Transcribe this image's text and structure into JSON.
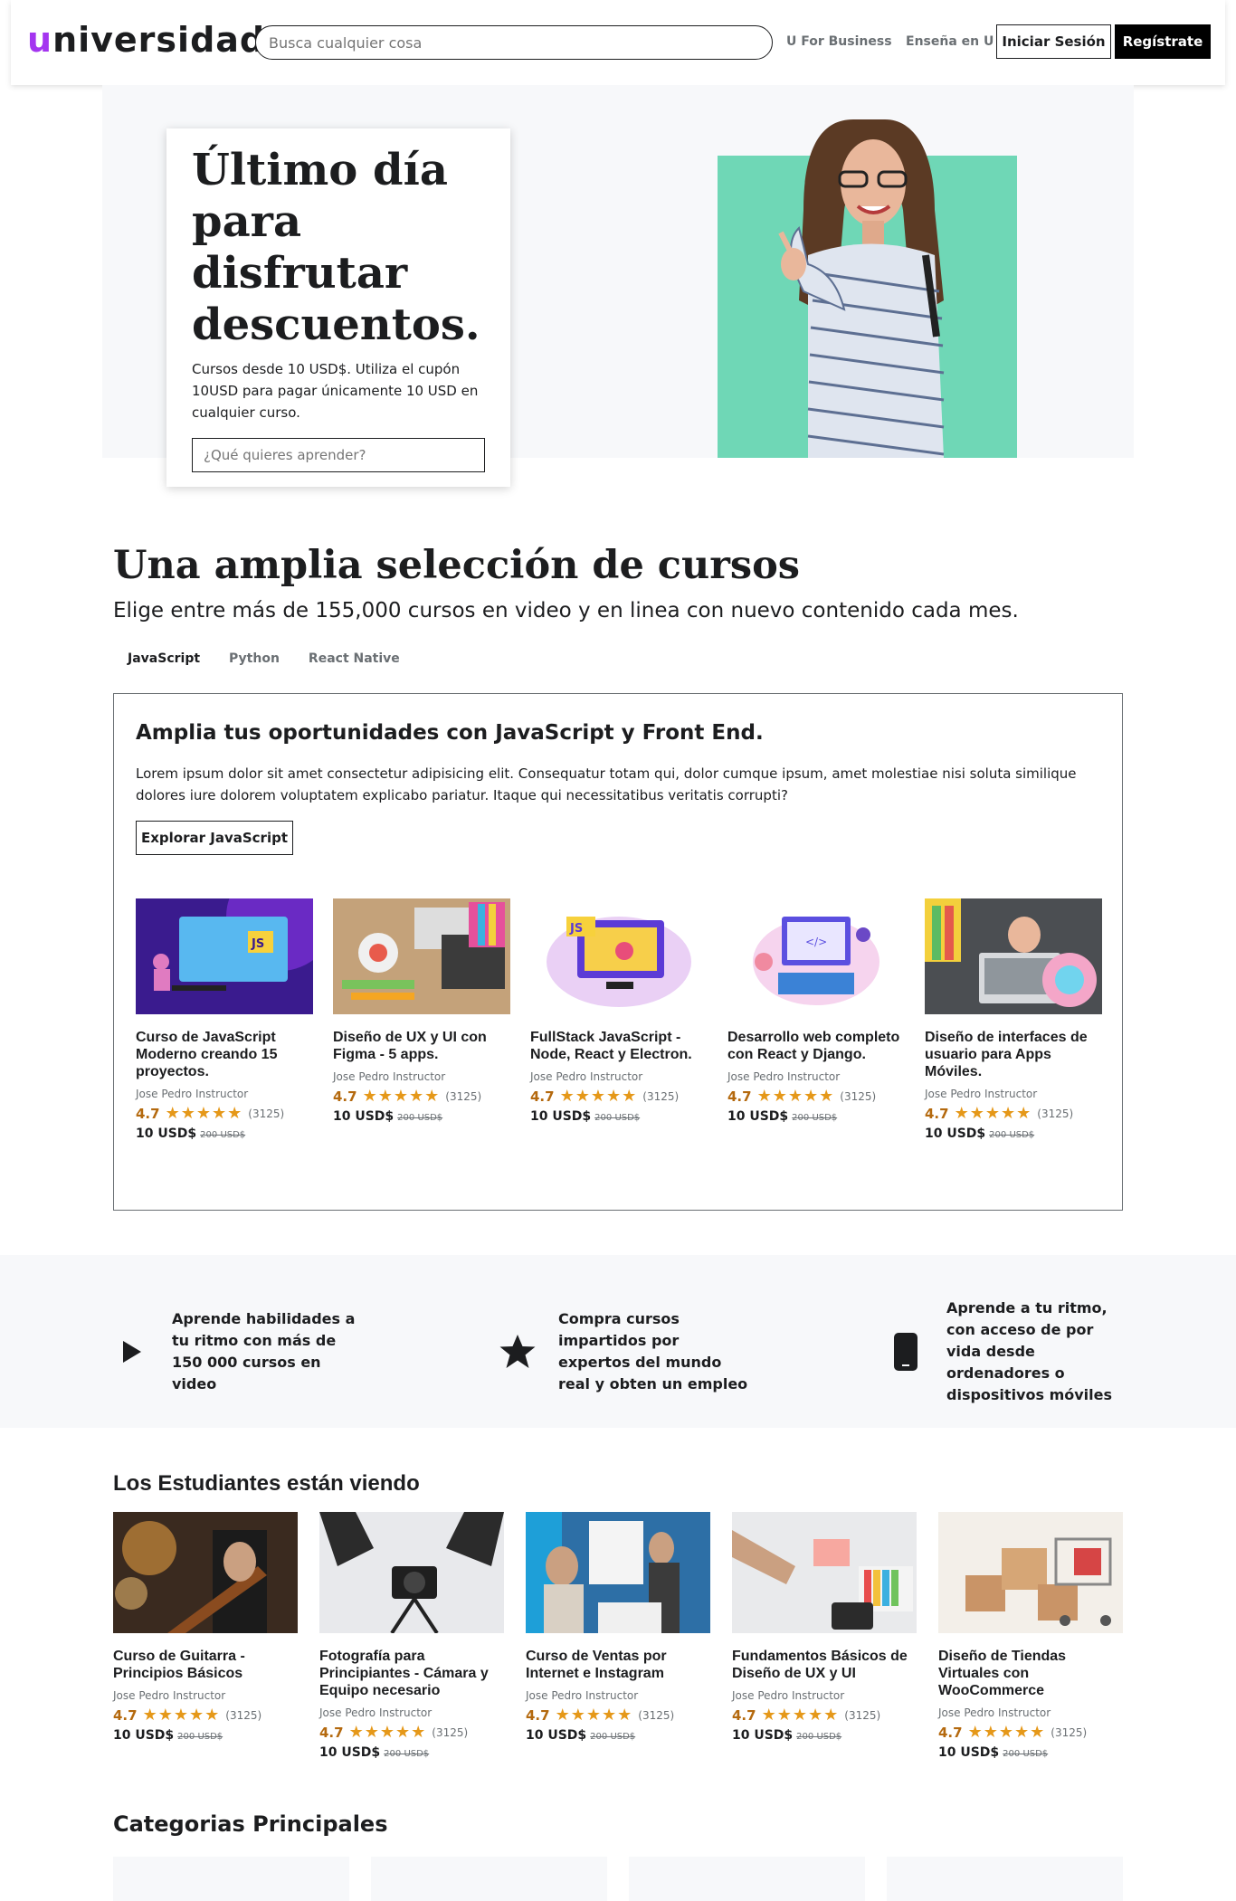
{
  "header": {
    "logo_first": "u",
    "logo_rest": "niversidad",
    "search_placeholder": "Busca cualquier cosa",
    "business_link": "U For Business",
    "teach_link": "Enseña en U",
    "login_label": "Iniciar Sesión",
    "register_label": "Regístrate"
  },
  "hero": {
    "title": "Último día para disfrutar descuentos.",
    "text": "Cursos desde 10 USD$. Utiliza el cupón 10USD para pagar únicamente 10 USD en cualquier curso.",
    "search_placeholder": "¿Qué quieres aprender?"
  },
  "selection": {
    "title": "Una amplia selección de cursos",
    "subtitle": "Elige entre más de 155,000 cursos en video y en linea con nuevo contenido cada mes.",
    "tabs": [
      "JavaScript",
      "Python",
      "React Native"
    ],
    "box_title": "Amplia tus oportunidades con JavaScript y Front End.",
    "box_text": "Lorem ipsum dolor sit amet consectetur adipisicing elit. Consequatur totam qui, dolor cumque ipsum, amet molestiae nisi soluta similique dolores iure dolorem voluptatem explicabo pariatur. Itaque qui necessitatibus veritatis corrupti?",
    "box_button": "Explorar JavaScript",
    "courses": [
      {
        "title": "Curso de JavaScript Moderno creando 15 proyectos.",
        "instructor": "Jose Pedro Instructor",
        "rating": "4.7",
        "stars": "★★★★★",
        "count": "(3125)",
        "price": "10 USD$",
        "old_price": "200 USD$"
      },
      {
        "title": "Diseño de UX y UI con Figma - 5 apps.",
        "instructor": "Jose Pedro Instructor",
        "rating": "4.7",
        "stars": "★★★★★",
        "count": "(3125)",
        "price": "10 USD$",
        "old_price": "200 USD$"
      },
      {
        "title": "FullStack JavaScript - Node, React y Electron.",
        "instructor": "Jose Pedro Instructor",
        "rating": "4.7",
        "stars": "★★★★★",
        "count": "(3125)",
        "price": "10 USD$",
        "old_price": "200 USD$"
      },
      {
        "title": "Desarrollo web completo con React y Django.",
        "instructor": "Jose Pedro Instructor",
        "rating": "4.7",
        "stars": "★★★★★",
        "count": "(3125)",
        "price": "10 USD$",
        "old_price": "200 USD$"
      },
      {
        "title": "Diseño de interfaces de usuario para Apps Móviles.",
        "instructor": "Jose Pedro Instructor",
        "rating": "4.7",
        "stars": "★★★★★",
        "count": "(3125)",
        "price": "10 USD$",
        "old_price": "200 USD$"
      }
    ]
  },
  "features": [
    {
      "icon": "play-icon",
      "text": "Aprende habilidades a tu ritmo con más de 150 000 cursos en video"
    },
    {
      "icon": "star-icon",
      "text": "Compra cursos impartidos por expertos del mundo real y obten un empleo"
    },
    {
      "icon": "mobile-icon",
      "text": "Aprende a tu ritmo, con acceso de por vida desde ordenadores o dispositivos móviles"
    }
  ],
  "students": {
    "title": "Los Estudiantes están viendo",
    "courses": [
      {
        "title": "Curso de Guitarra - Principios Básicos",
        "instructor": "Jose Pedro Instructor",
        "rating": "4.7",
        "stars": "★★★★★",
        "count": "(3125)",
        "price": "10 USD$",
        "old_price": "200 USD$"
      },
      {
        "title": "Fotografía para Principiantes - Cámara y Equipo necesario",
        "instructor": "Jose Pedro Instructor",
        "rating": "4.7",
        "stars": "★★★★★",
        "count": "(3125)",
        "price": "10 USD$",
        "old_price": "200 USD$"
      },
      {
        "title": "Curso de Ventas por Internet e Instagram",
        "instructor": "Jose Pedro Instructor",
        "rating": "4.7",
        "stars": "★★★★★",
        "count": "(3125)",
        "price": "10 USD$",
        "old_price": "200 USD$"
      },
      {
        "title": "Fundamentos Básicos de Diseño de UX y UI",
        "instructor": "Jose Pedro Instructor",
        "rating": "4.7",
        "stars": "★★★★★",
        "count": "(3125)",
        "price": "10 USD$",
        "old_price": "200 USD$"
      },
      {
        "title": "Diseño de Tiendas Virtuales con WooCommerce",
        "instructor": "Jose Pedro Instructor",
        "rating": "4.7",
        "stars": "★★★★★",
        "count": "(3125)",
        "price": "10 USD$",
        "old_price": "200 USD$"
      }
    ]
  },
  "categories": {
    "title": "Categorias Principales"
  },
  "colors": {
    "accent": "#a435f0",
    "hero_bg": "#6fd7b6",
    "rating": "#b4690e",
    "stars": "#e59819"
  }
}
